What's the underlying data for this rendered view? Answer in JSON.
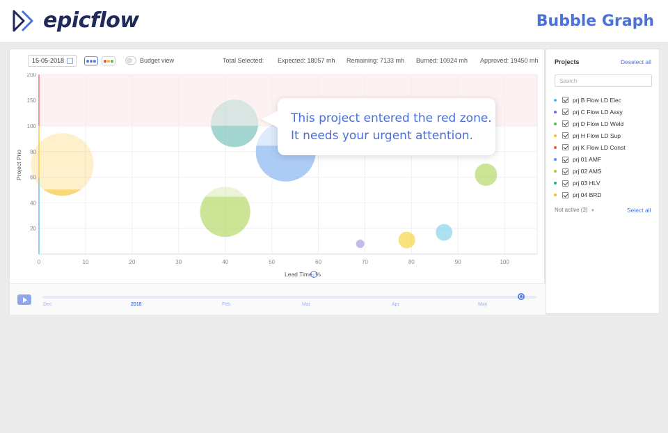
{
  "header": {
    "logo_text": "epicflow",
    "page_title": "Bubble Graph",
    "brand_color": "#1f2a5a",
    "accent_color": "#4a72d9"
  },
  "toolbar": {
    "date": "15-05-2018",
    "budget_view_label": "Budget view",
    "total_selected_label": "Total Selected:",
    "expected": "Expected: 18057 mh",
    "remaining": "Remaining: 7133 mh",
    "burned": "Burned: 10924 mh",
    "approved": "Approved: 19450 mh"
  },
  "callout": {
    "line1": "This project entered the red zone.",
    "line2": "It needs your urgent attention."
  },
  "chart_data": {
    "type": "scatter",
    "xlabel": "Lead Time, %",
    "ylabel": "Project Prio",
    "xlim": [
      0,
      107
    ],
    "ylim": [
      0,
      200
    ],
    "x_ticks": [
      0,
      10,
      20,
      30,
      40,
      50,
      60,
      70,
      80,
      90,
      100
    ],
    "y_ticks": [
      20,
      40,
      60,
      80,
      100,
      150,
      200
    ],
    "red_zone_from": 100,
    "grid": true,
    "bubbles": [
      {
        "project": "prj H Flow LD Sup",
        "x": 5,
        "y": 70,
        "size": 45,
        "progress": 0.1,
        "color": "#f7c843"
      },
      {
        "project": "prj B Flow LD Elec",
        "x": 42,
        "y": 105,
        "size": 34,
        "progress": 0.45,
        "color": "#7cc4bb"
      },
      {
        "project": "prj 01 AMF",
        "x": 53,
        "y": 80,
        "size": 43,
        "progress": 0.6,
        "color": "#8ab8f2"
      },
      {
        "project": "prj D Flow LD Weld",
        "x": 40,
        "y": 33,
        "size": 36,
        "progress": 0.8,
        "color": "#b6d86a"
      },
      {
        "project": "prj 02 AMS",
        "x": 96,
        "y": 62,
        "size": 16,
        "progress": 1,
        "color": "#b6d86a"
      },
      {
        "project": "prj C Flow LD Assy",
        "x": 69,
        "y": 8,
        "size": 6,
        "progress": 1,
        "color": "#a7a2e0"
      },
      {
        "project": "prj 04 BRD",
        "x": 79,
        "y": 11,
        "size": 12,
        "progress": 1,
        "color": "#f7d64a"
      },
      {
        "project": "prj 03 HLV",
        "x": 87,
        "y": 17,
        "size": 12,
        "progress": 1,
        "color": "#8ad6ea"
      }
    ]
  },
  "timeline": {
    "labels": [
      "Dec",
      "2018",
      "Feb",
      "Mar",
      "Apr",
      "May"
    ],
    "position": 0.97
  },
  "sidebar": {
    "title": "Projects",
    "deselect_all": "Deselect all",
    "search_placeholder": "Search",
    "projects": [
      {
        "label": "prj B Flow LD Elec",
        "color": "#4bb8e8"
      },
      {
        "label": "prj C Flow LD Assy",
        "color": "#6a6fd6"
      },
      {
        "label": "prj D Flow LD Weld",
        "color": "#4fbf4f"
      },
      {
        "label": "prj H Flow LD Sup",
        "color": "#f2c22b"
      },
      {
        "label": "prj K Flow LD Const",
        "color": "#e85d3a"
      },
      {
        "label": "prj 01 AMF",
        "color": "#5b8ef0"
      },
      {
        "label": "prj 02 AMS",
        "color": "#a6cf3f"
      },
      {
        "label": "prj 03 HLV",
        "color": "#1fae8a"
      },
      {
        "label": "prj 04 BRD",
        "color": "#f2c22b"
      }
    ],
    "not_active": "Not active (3)",
    "select_all": "Select all"
  }
}
